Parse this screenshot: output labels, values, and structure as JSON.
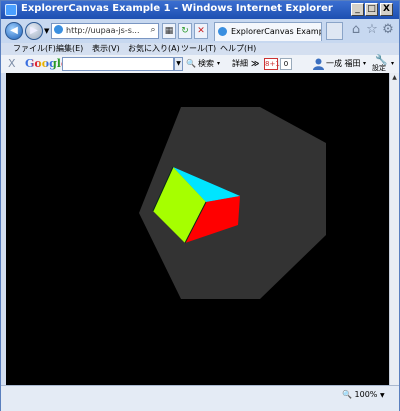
{
  "window": {
    "title": "ExplorerCanvas Example 1 - Windows Internet Explorer",
    "minimize_label": "_",
    "maximize_label": "□",
    "close_label": "X"
  },
  "address_bar": {
    "url": "http://uupaa-js-s...",
    "search_glyph": "⌕",
    "dropdown_glyph": "▾",
    "tab_title": "ExplorerCanvas Exampl...",
    "home_glyph": "⌂",
    "favorite_glyph": "☆",
    "tools_glyph": "⚙"
  },
  "menu": {
    "items": [
      "ファイル(F)",
      "編集(E)",
      "表示(V)",
      "お気に入り(A)",
      "ツール(T)",
      "ヘルプ(H)"
    ]
  },
  "google_toolbar": {
    "close_glyph": "X",
    "logo": "Google",
    "search_button": "検索",
    "details": "詳細",
    "more": "≫",
    "plus_one": "8+1",
    "plus_count": "0",
    "user_name": "一成 福田",
    "settings": "設定"
  },
  "status_bar": {
    "zoom": "100%"
  },
  "scene": {
    "background": "#000000",
    "hexagon_color": "#333333",
    "cube_top": "#00e5ff",
    "cube_left_face": "#a6ff00",
    "cube_right_face": "#ff0000",
    "cube_back": "#1a6fb0"
  }
}
